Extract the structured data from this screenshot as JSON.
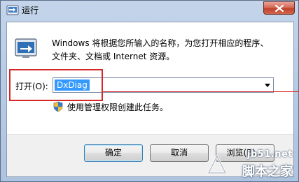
{
  "window": {
    "title": "运行",
    "close_icon": "close-icon"
  },
  "main": {
    "description": "Windows 将根据您所输入的名称，为您打开相应的程序、\n文件夹、文档或 Internet 资源。",
    "open_label": "打开(O):",
    "open_value": "DxDiag",
    "admin_note": "使用管理权限创建此任务。"
  },
  "buttons": {
    "ok": "确定",
    "cancel": "取消",
    "browse": "浏览(B)..."
  },
  "watermark": {
    "url": "jb51.net",
    "name": "脚本之家"
  },
  "colors": {
    "highlight": "#d62828",
    "selection": "#3399ff"
  }
}
